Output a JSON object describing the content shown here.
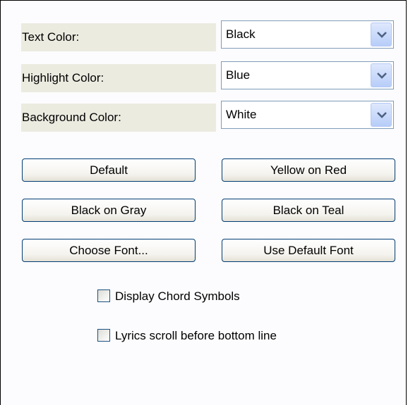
{
  "fields": [
    {
      "label": "Text Color:",
      "value": "Black"
    },
    {
      "label": "Highlight Color:",
      "value": "Blue"
    },
    {
      "label": "Background Color:",
      "value": "White"
    }
  ],
  "buttons": {
    "default": "Default",
    "yellow_on_red": "Yellow on Red",
    "black_on_gray": "Black on Gray",
    "black_on_teal": "Black on Teal",
    "choose_font": "Choose Font...",
    "use_default_font": "Use Default Font"
  },
  "checkboxes": [
    {
      "label": "Display Chord Symbols",
      "checked": false
    },
    {
      "label": "Lyrics scroll before bottom line",
      "checked": false
    }
  ],
  "icons": {
    "dropdown": "chevron-down-icon"
  },
  "colors": {
    "label_bg": "#ecebe0",
    "button_border": "#003c74",
    "dropdown_button": "#c4d6fb",
    "chevron": "#4d6185"
  }
}
